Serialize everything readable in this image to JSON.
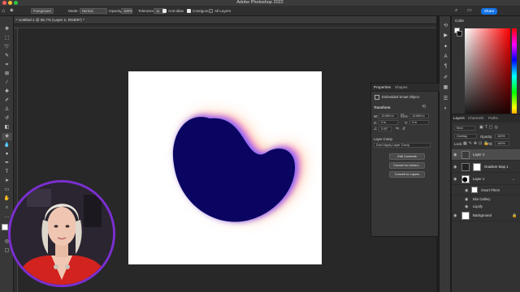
{
  "app": {
    "title": "Adobe Photoshop 2022"
  },
  "window_controls": [
    {
      "name": "close",
      "color": "#ff5f57"
    },
    {
      "name": "minimize",
      "color": "#febc2e"
    },
    {
      "name": "maximize",
      "color": "#28c840"
    }
  ],
  "options_bar": {
    "fill_source": "Foreground",
    "mode_label": "Mode:",
    "mode_value": "Normal",
    "opacity_label": "Opacity:",
    "opacity_value": "100%",
    "tolerance_label": "Tolerance:",
    "tolerance_value": "11",
    "anti_alias": "Anti-alias",
    "contiguous": "Contiguous",
    "all_layers": "All Layers",
    "share_label": "Share"
  },
  "document_tab": {
    "label": "Untitled-1 @ 66.7% (Layer 2, RGB/8*) *"
  },
  "properties_panel": {
    "tabs": [
      "Properties",
      "Shapes"
    ],
    "object_type": "Embedded Smart Object",
    "transform_label": "Transform",
    "w_label": "W:",
    "w_value": "13.889 in",
    "h_label": "H:",
    "h_value": "13.889 in",
    "x_label": "X:",
    "x_value": "0 in",
    "y_label": "Y:",
    "y_value": "0 in",
    "angle_value": "0.00°",
    "layer_comp_label": "Layer Comp",
    "layer_comp_value": "Don't Apply Layer Comp",
    "buttons": [
      "Edit Contents",
      "Convert to Linked...",
      "Convert to Layers"
    ]
  },
  "color_panel": {
    "tab": "Color"
  },
  "layers_panel": {
    "tabs": [
      "Layers",
      "Channels",
      "Paths"
    ],
    "filter_kind": "Kind",
    "blend_mode": "Overlay",
    "opacity_label": "Opacity:",
    "opacity_value": "100%",
    "lock_label": "Lock:",
    "fill_label": "Fill:",
    "fill_value": "100%",
    "layers": [
      {
        "name": "Layer 2",
        "selected": true
      },
      {
        "name": "Gradient Map 1",
        "selected": false
      },
      {
        "name": "Layer 1",
        "selected": false
      },
      {
        "name": "Smart Filters",
        "selected": false
      },
      {
        "name": "Blur Gallery",
        "selected": false
      },
      {
        "name": "Liquify",
        "selected": false
      },
      {
        "name": "Background",
        "selected": false
      }
    ]
  },
  "canvas": {
    "blob_fill": "#0a0560",
    "glow_inner": "#6a5cff",
    "glow_mid": "#ff8fd0",
    "glow_outer": "#ffc79c"
  }
}
